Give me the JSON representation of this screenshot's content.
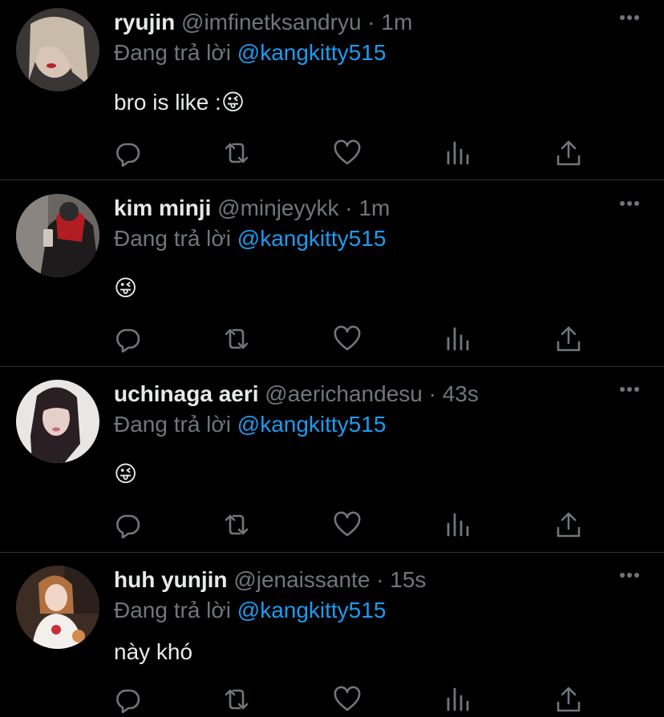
{
  "reply_prefix": "Đang trả lời",
  "tweets": [
    {
      "name": "ryujin",
      "handle": "@imfinetksandryu",
      "time": "1m",
      "reply_to": "@kangkitty515",
      "text": "bro is like :😜"
    },
    {
      "name": "kim minji",
      "handle": "@minjeyykk",
      "time": "1m",
      "reply_to": "@kangkitty515",
      "text": "😜"
    },
    {
      "name": "uchinaga aeri",
      "handle": "@aerichandesu",
      "time": "43s",
      "reply_to": "@kangkitty515",
      "text": "😜"
    },
    {
      "name": "huh yunjin",
      "handle": "@jenaissante",
      "time": "15s",
      "reply_to": "@kangkitty515",
      "text": "này khó"
    }
  ],
  "separator": " · ",
  "colors": {
    "background": "#000000",
    "text": "#e7e9ea",
    "muted": "#71767b",
    "link": "#1d9bf0",
    "divider": "#2f3336"
  },
  "icons": [
    "reply-icon",
    "retweet-icon",
    "like-icon",
    "analytics-icon",
    "share-icon",
    "more-icon"
  ]
}
